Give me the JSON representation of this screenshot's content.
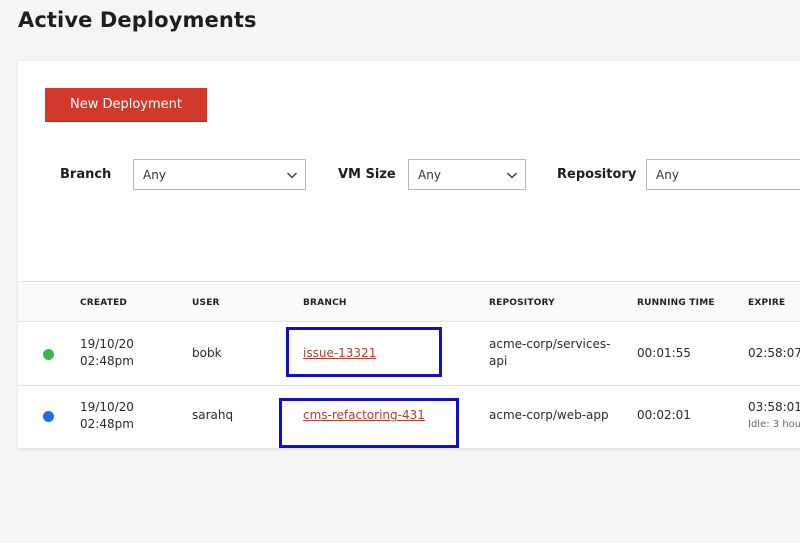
{
  "page": {
    "title": "Active Deployments"
  },
  "toolbar": {
    "new_deployment_label": "New Deployment"
  },
  "filters": {
    "branch": {
      "label": "Branch",
      "value": "Any"
    },
    "vm_size": {
      "label": "VM Size",
      "value": "Any"
    },
    "repository": {
      "label": "Repository",
      "value": "Any"
    }
  },
  "table": {
    "columns": [
      "CREATED",
      "USER",
      "BRANCH",
      "REPOSITORY",
      "RUNNING TIME",
      "EXPIRE"
    ],
    "rows": [
      {
        "status": "green",
        "created_date": "19/10/20",
        "created_time": "02:48pm",
        "user": "bobk",
        "branch": "issue-13321",
        "repository_line1": "acme-corp/services-",
        "repository_line2": "api",
        "running_time": "00:01:55",
        "expire": "02:58:07",
        "expire_note": ""
      },
      {
        "status": "blue",
        "created_date": "19/10/20",
        "created_time": "02:48pm",
        "user": "sarahq",
        "branch": "cms-refactoring-431",
        "repository_line1": "acme-corp/web-app",
        "repository_line2": "",
        "running_time": "00:02:01",
        "expire": "03:58:01",
        "expire_note": "Idle: 3 hou"
      }
    ]
  },
  "colors": {
    "accent": "#d0392b",
    "status_green": "#3cb84a",
    "status_blue": "#1f6fe0",
    "highlight_box": "#1010c8"
  }
}
